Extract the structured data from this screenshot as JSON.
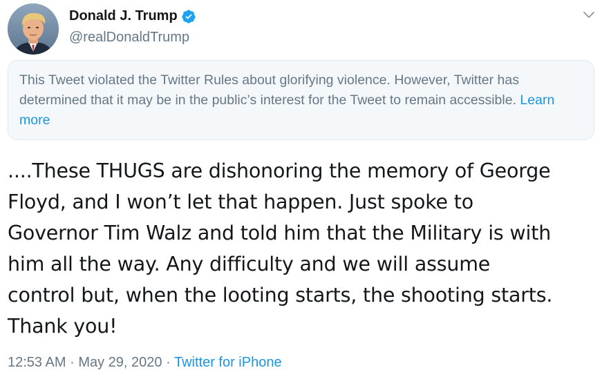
{
  "author": {
    "display_name": "Donald J. Trump",
    "handle": "@realDonaldTrump",
    "verified": true,
    "avatar": "profile-photo"
  },
  "notice": {
    "text": "This Tweet violated the Twitter Rules about glorifying violence. However, Twitter has determined that it may be in the public’s interest for the Tweet to remain accessible.",
    "link_label": "Learn more"
  },
  "tweet": {
    "text": "....These THUGS are dishonoring the memory of George\nFloyd, and I won’t let that happen. Just spoke to\nGovernor Tim Walz and told him that the Military is with\nhim all the way. Any difficulty and we will assume\ncontrol but, when the looting starts, the shooting starts.\nThank you!"
  },
  "meta": {
    "time": "12:53 AM",
    "separator": "·",
    "date": "May 29, 2020",
    "source": "Twitter for iPhone"
  },
  "icons": {
    "verified": "verified-badge-icon",
    "caret": "chevron-down-icon"
  },
  "colors": {
    "link": "#1b95e0",
    "secondary_text": "#657786",
    "notice_bg": "#f5f8fa",
    "verified": "#1da1f2"
  }
}
